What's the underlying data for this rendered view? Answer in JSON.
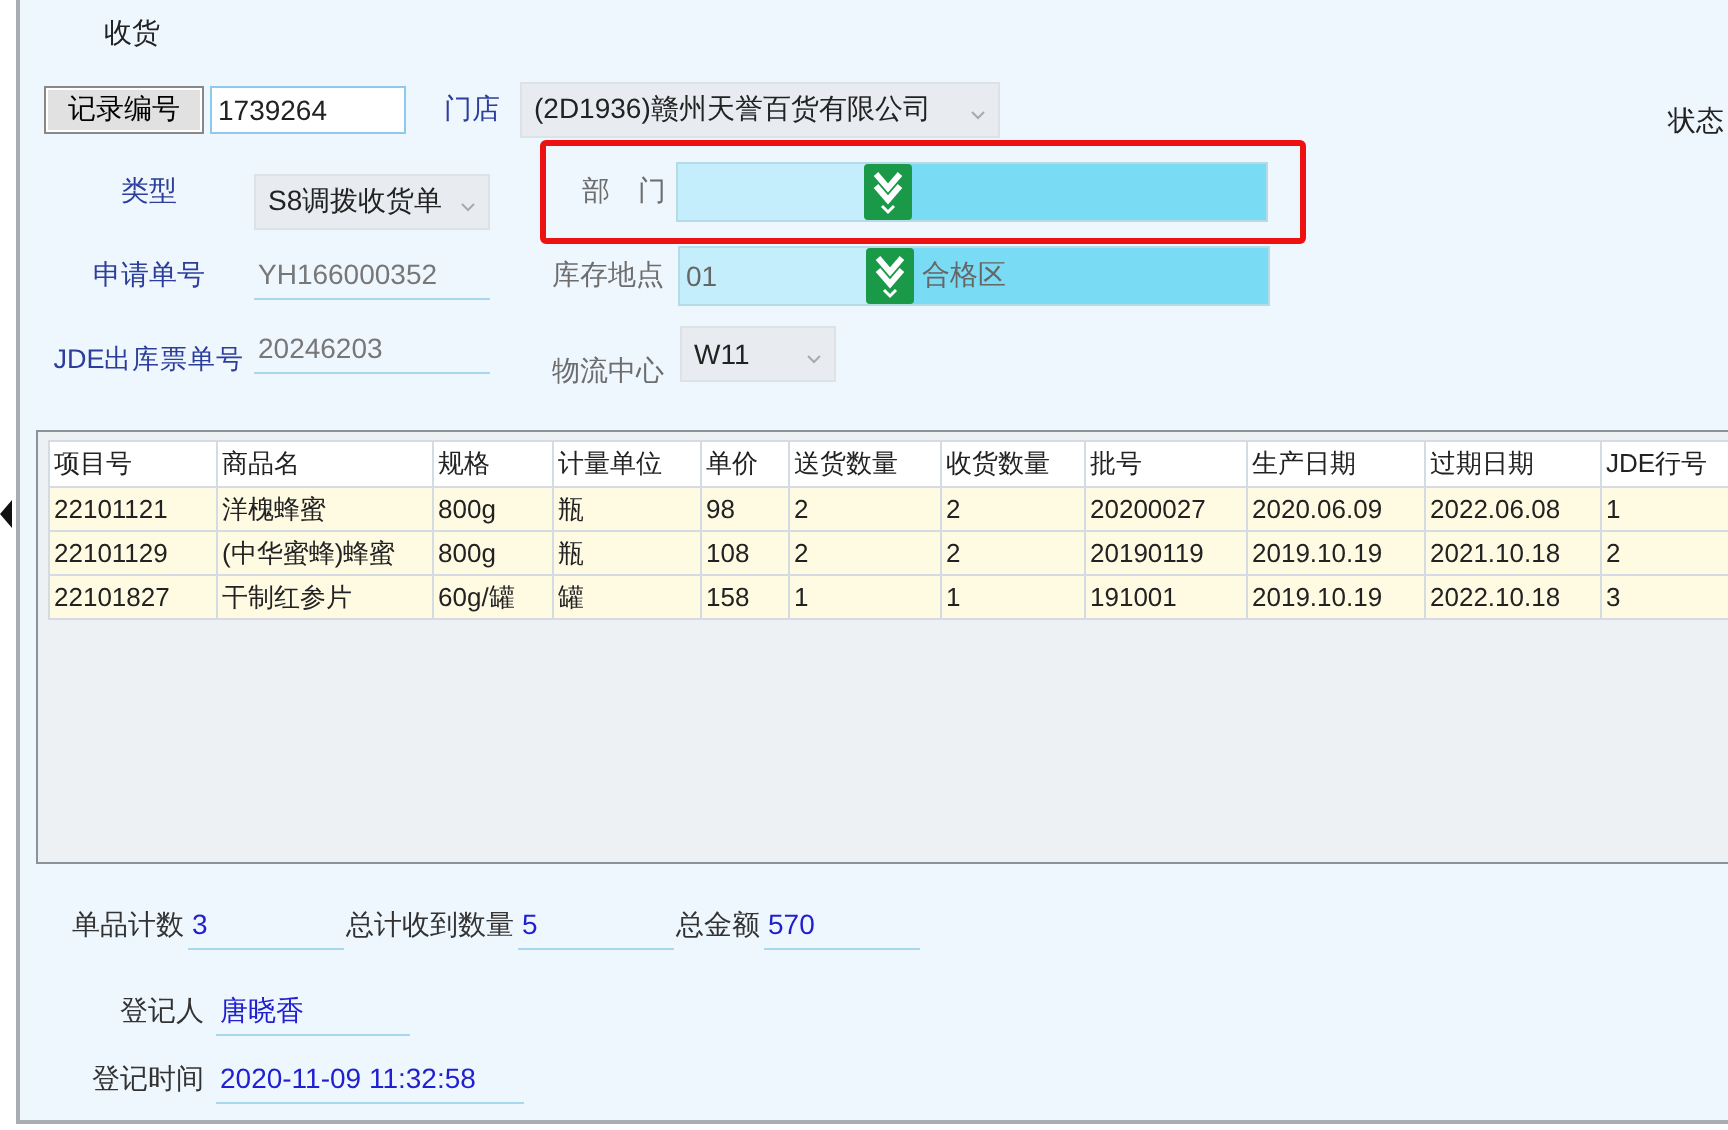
{
  "window": {
    "title": "收货"
  },
  "record": {
    "button": "记录编号",
    "value": "1739264"
  },
  "store": {
    "label": "门店",
    "value": "(2D1936)赣州天誉百货有限公司"
  },
  "status": {
    "label": "状态"
  },
  "type": {
    "label": "类型",
    "value": "S8调拨收货单"
  },
  "department": {
    "label": "部　门",
    "highlighted": true
  },
  "request_no": {
    "label": "申请单号",
    "value": "YH166000352"
  },
  "location": {
    "label": "库存地点",
    "code": "01",
    "name": "合格区"
  },
  "jde_no": {
    "label": "JDE出库票单号",
    "value": "20246203"
  },
  "logistics": {
    "label": "物流中心",
    "value": "W11"
  },
  "table": {
    "columns": [
      "项目号",
      "商品名",
      "规格",
      "计量单位",
      "单价",
      "送货数量",
      "收货数量",
      "批号",
      "生产日期",
      "过期日期",
      "JDE行号"
    ],
    "rows": [
      [
        "22101121",
        "洋槐蜂蜜",
        "800g",
        "瓶",
        "98",
        "2",
        "2",
        "20200027",
        "2020.06.09",
        "2022.06.08",
        "1"
      ],
      [
        "22101129",
        "(中华蜜蜂)蜂蜜",
        "800g",
        "瓶",
        "108",
        "2",
        "2",
        "20190119",
        "2019.10.19",
        "2021.10.18",
        "2"
      ],
      [
        "22101827",
        "干制红参片",
        "60g/罐",
        "罐",
        "158",
        "1",
        "1",
        "191001",
        "2019.10.19",
        "2022.10.18",
        "3"
      ]
    ]
  },
  "summary": [
    {
      "label": "单品计数",
      "value": "3"
    },
    {
      "label": "总计收到数量",
      "value": "5"
    },
    {
      "label": "总金额",
      "value": "570"
    }
  ],
  "registrar": {
    "label": "登记人",
    "value": "唐晓香"
  },
  "registered_at": {
    "label": "登记时间",
    "value": "2020-11-09 11:32:58"
  }
}
